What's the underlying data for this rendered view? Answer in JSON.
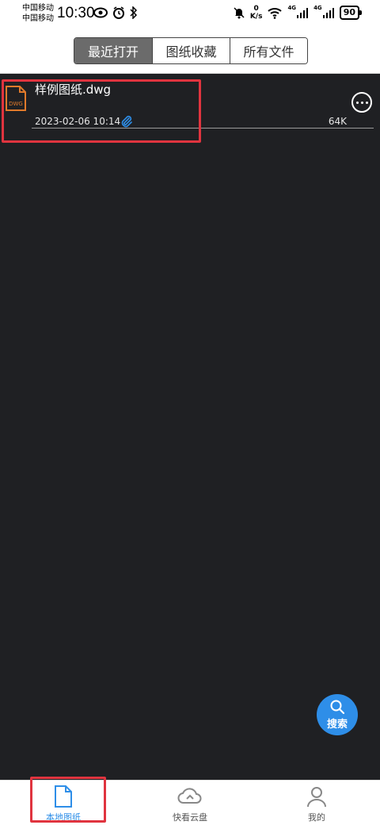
{
  "status_bar": {
    "carrier1": "中国移动",
    "carrier2": "中国移动",
    "time": "10:30",
    "net_speed_value": "0",
    "net_speed_unit": "K/s",
    "signal_label_1": "4G",
    "signal_label_2": "4G",
    "battery": "90"
  },
  "tabs": [
    {
      "label": "最近打开",
      "active": true
    },
    {
      "label": "图纸收藏",
      "active": false
    },
    {
      "label": "所有文件",
      "active": false
    }
  ],
  "files": [
    {
      "name": "样例图纸.dwg",
      "date": "2023-02-06 10:14",
      "size": "64K",
      "icon_label": "DWG"
    }
  ],
  "search_fab": {
    "label": "搜索"
  },
  "bottom_nav": [
    {
      "label": "本地图纸",
      "icon": "document-icon",
      "active": true
    },
    {
      "label": "快看云盘",
      "icon": "cloud-icon",
      "active": false
    },
    {
      "label": "我的",
      "icon": "person-icon",
      "active": false
    }
  ],
  "colors": {
    "accent": "#2e8ee8",
    "background": "#1f2023",
    "highlight": "#e0343f",
    "file_icon": "#e07a2b"
  }
}
